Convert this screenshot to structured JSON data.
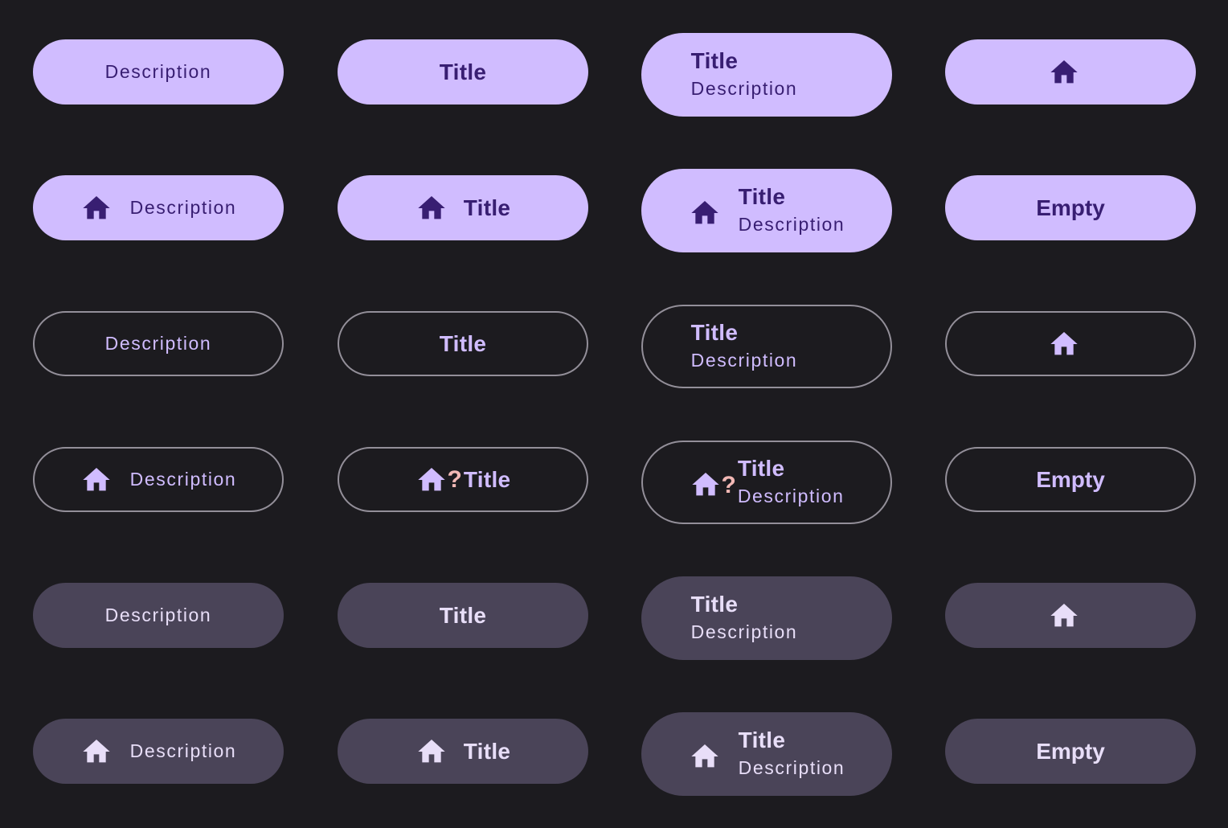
{
  "colors": {
    "background": "#1c1b1f",
    "filled_container": "#d0bcff",
    "on_filled": "#381e72",
    "outline": "#938f99",
    "outlined_content": "#d0bcff",
    "tonal_container": "#4a4458",
    "on_tonal": "#e8def8",
    "missing_glyph": "#f2b8b5"
  },
  "labels": {
    "description": "Description",
    "title": "Title",
    "empty": "Empty",
    "missing_glyph": "?"
  },
  "icons": {
    "home": "home-icon"
  },
  "rows": [
    {
      "style": "filled",
      "has_icon": false,
      "buttons": [
        {
          "variant": "description-only",
          "description": "Description"
        },
        {
          "variant": "title-only",
          "title": "Title"
        },
        {
          "variant": "title-description",
          "title": "Title",
          "description": "Description"
        },
        {
          "variant": "icon-only",
          "icon": "home-icon"
        }
      ]
    },
    {
      "style": "filled",
      "has_icon": true,
      "buttons": [
        {
          "variant": "icon-description",
          "icon": "home-icon",
          "description": "Description"
        },
        {
          "variant": "icon-title",
          "icon": "home-icon",
          "title": "Title"
        },
        {
          "variant": "icon-title-description",
          "icon": "home-icon",
          "title": "Title",
          "description": "Description"
        },
        {
          "variant": "empty",
          "label": "Empty"
        }
      ]
    },
    {
      "style": "outlined",
      "has_icon": false,
      "buttons": [
        {
          "variant": "description-only",
          "description": "Description"
        },
        {
          "variant": "title-only",
          "title": "Title"
        },
        {
          "variant": "title-description",
          "title": "Title",
          "description": "Description"
        },
        {
          "variant": "icon-only",
          "icon": "home-icon"
        }
      ]
    },
    {
      "style": "outlined",
      "has_icon": true,
      "buttons": [
        {
          "variant": "icon-description",
          "icon": "home-icon",
          "description": "Description"
        },
        {
          "variant": "icon-title",
          "icon": "home-icon",
          "title": "Title",
          "glyph": "?"
        },
        {
          "variant": "icon-title-description",
          "icon": "home-icon",
          "title": "Title",
          "description": "Description",
          "glyph": "?"
        },
        {
          "variant": "empty",
          "label": "Empty"
        }
      ]
    },
    {
      "style": "tonal",
      "has_icon": false,
      "buttons": [
        {
          "variant": "description-only",
          "description": "Description"
        },
        {
          "variant": "title-only",
          "title": "Title"
        },
        {
          "variant": "title-description",
          "title": "Title",
          "description": "Description"
        },
        {
          "variant": "icon-only",
          "icon": "home-icon"
        }
      ]
    },
    {
      "style": "tonal",
      "has_icon": true,
      "buttons": [
        {
          "variant": "icon-description",
          "icon": "home-icon",
          "description": "Description"
        },
        {
          "variant": "icon-title",
          "icon": "home-icon",
          "title": "Title"
        },
        {
          "variant": "icon-title-description",
          "icon": "home-icon",
          "title": "Title",
          "description": "Description"
        },
        {
          "variant": "empty",
          "label": "Empty"
        }
      ]
    }
  ]
}
